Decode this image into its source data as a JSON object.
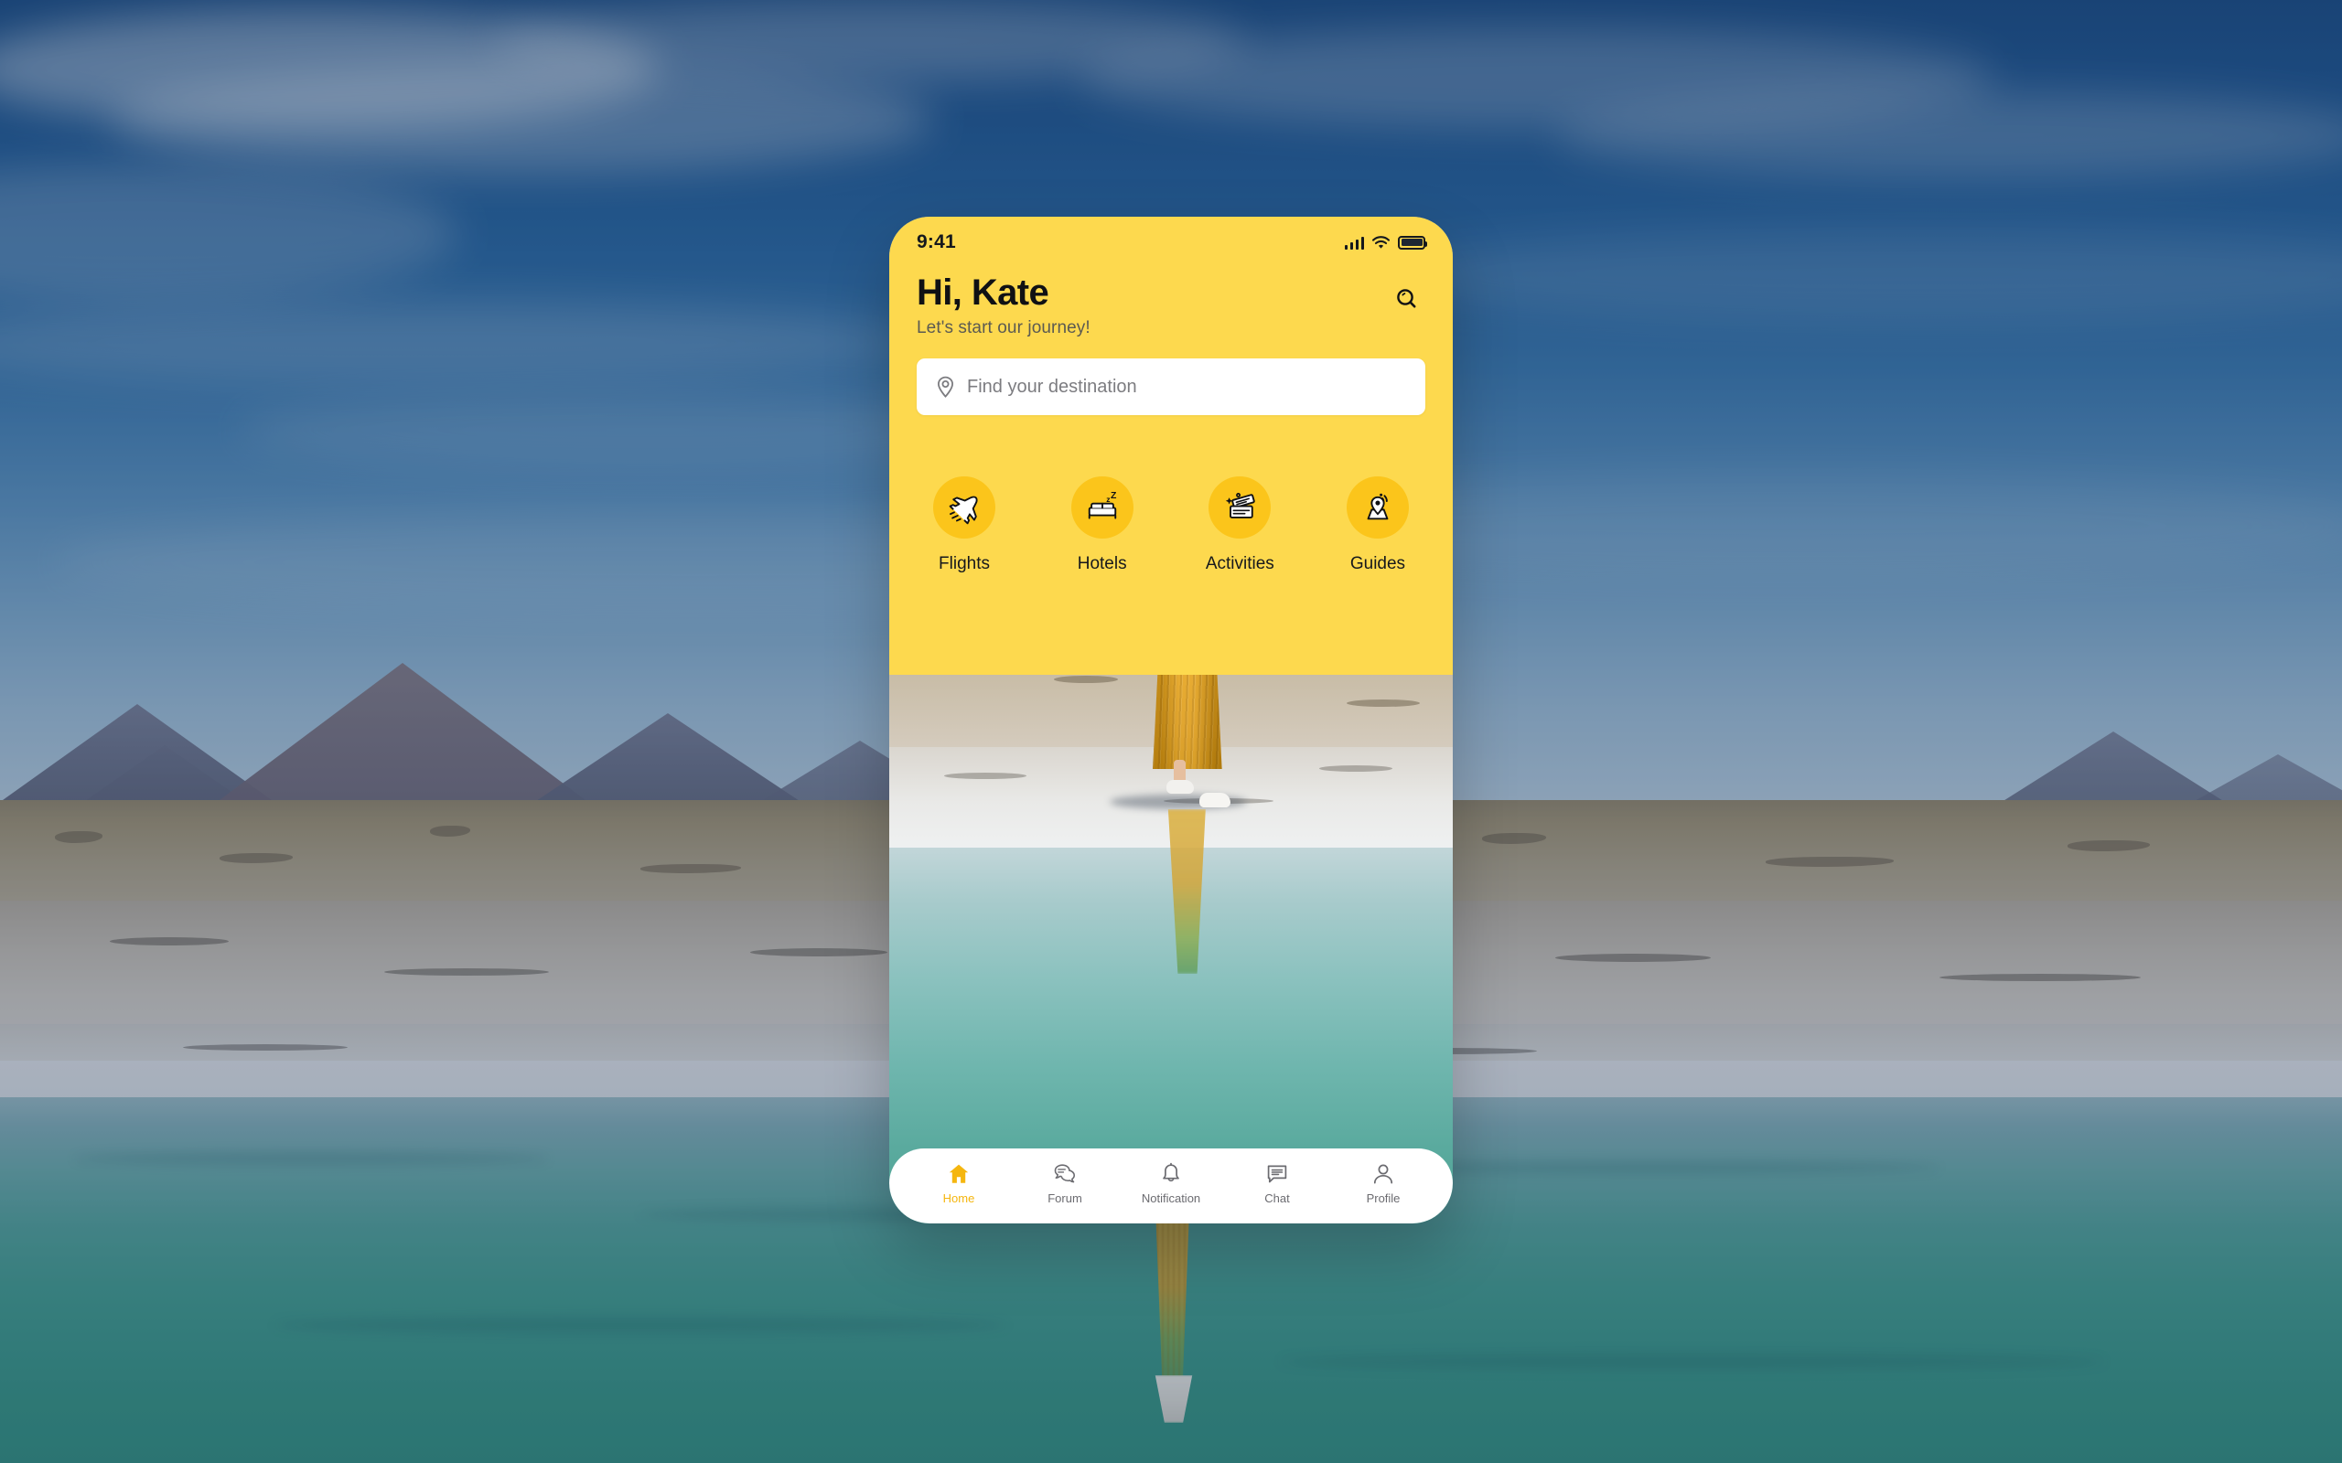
{
  "app": {
    "accent_yellow": "#FDD94E",
    "icon_circle_yellow": "#FBC51B",
    "active_nav_color": "#F5B60F"
  },
  "status_bar": {
    "time": "9:41",
    "cellular_icon": "cellular-signal-icon",
    "wifi_icon": "wifi-icon",
    "battery_icon": "battery-full-icon"
  },
  "header": {
    "greeting": "Hi, Kate",
    "subtitle": "Let's start our journey!",
    "search_icon": "search-icon"
  },
  "search": {
    "placeholder": "Find your destination",
    "pin_icon": "location-pin-icon"
  },
  "categories": [
    {
      "label": "Flights",
      "icon": "airplane-icon"
    },
    {
      "label": "Hotels",
      "icon": "bed-sleep-icon"
    },
    {
      "label": "Activities",
      "icon": "tickets-icon"
    },
    {
      "label": "Guides",
      "icon": "map-pin-signal-icon"
    }
  ],
  "bottom_nav": [
    {
      "label": "Home",
      "icon": "home-icon",
      "active": true
    },
    {
      "label": "Forum",
      "icon": "forum-bubbles-icon",
      "active": false
    },
    {
      "label": "Notification",
      "icon": "bell-icon",
      "active": false
    },
    {
      "label": "Chat",
      "icon": "chat-bubble-icon",
      "active": false
    },
    {
      "label": "Profile",
      "icon": "person-icon",
      "active": false
    }
  ],
  "photo": {
    "description": "Woman in a yellow striped dress and white bucket hat walking on a salt flat beside a turquoise lake with mountains behind"
  }
}
